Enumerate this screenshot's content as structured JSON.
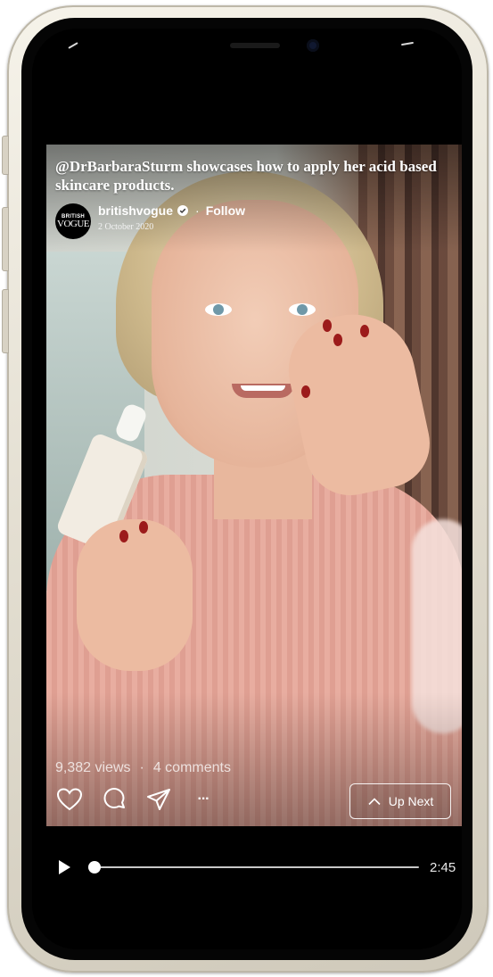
{
  "post": {
    "caption": "@DrBarbaraSturm showcases how to apply her acid based skincare products.",
    "avatar_brand_top": "BRITISH",
    "avatar_brand_bottom": "VOGUE",
    "username": "britishvogue",
    "separator": "·",
    "follow_label": "Follow",
    "date": "2 October 2020"
  },
  "stats": {
    "views": "9,382 views",
    "separator": "·",
    "comments": "4 comments"
  },
  "actions": {
    "icons": [
      "heart-icon",
      "comment-icon",
      "share-icon",
      "more-icon"
    ],
    "more_label": "···",
    "up_next_label": "Up Next"
  },
  "player": {
    "progress": 0.0,
    "duration": "2:45"
  },
  "colors": {
    "accent": "#ffffff",
    "verified": "#ffffff",
    "background": "#000000"
  }
}
